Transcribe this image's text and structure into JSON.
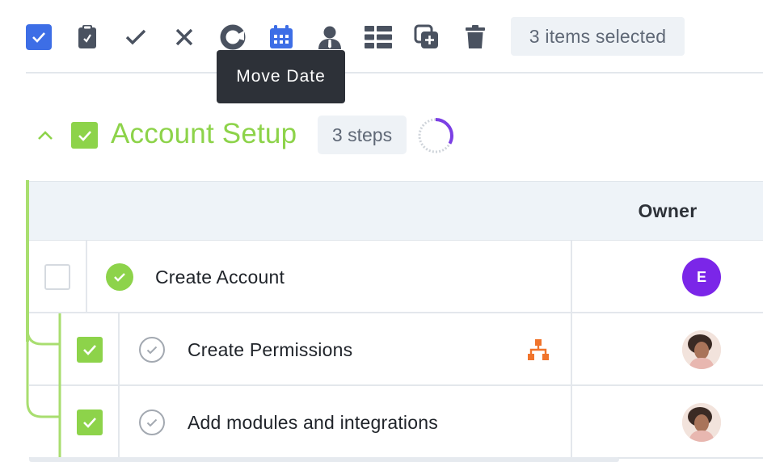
{
  "toolbar": {
    "selected_count_label": "3 items selected",
    "tooltip": "Move Date",
    "icons": [
      "checkbox-icon",
      "clipboard-icon",
      "check-icon",
      "close-icon",
      "progress-icon",
      "calendar-icon",
      "assignee-icon",
      "columns-icon",
      "duplicate-icon",
      "trash-icon"
    ]
  },
  "group": {
    "title": "Account Setup",
    "steps_label": "3 steps",
    "progress_fraction": 0.33,
    "colors": {
      "accent": "#8dd34a",
      "ring": "#7b3fe4"
    }
  },
  "table": {
    "columns": {
      "owner": "Owner"
    },
    "rows": [
      {
        "name": "Create Account",
        "checked": false,
        "done": true,
        "owner_initial": "E"
      },
      {
        "name": "Create Permissions",
        "checked": true,
        "done": false,
        "owner_type": "photo"
      },
      {
        "name": "Add modules and integrations",
        "checked": true,
        "done": false,
        "owner_type": "photo"
      }
    ]
  }
}
